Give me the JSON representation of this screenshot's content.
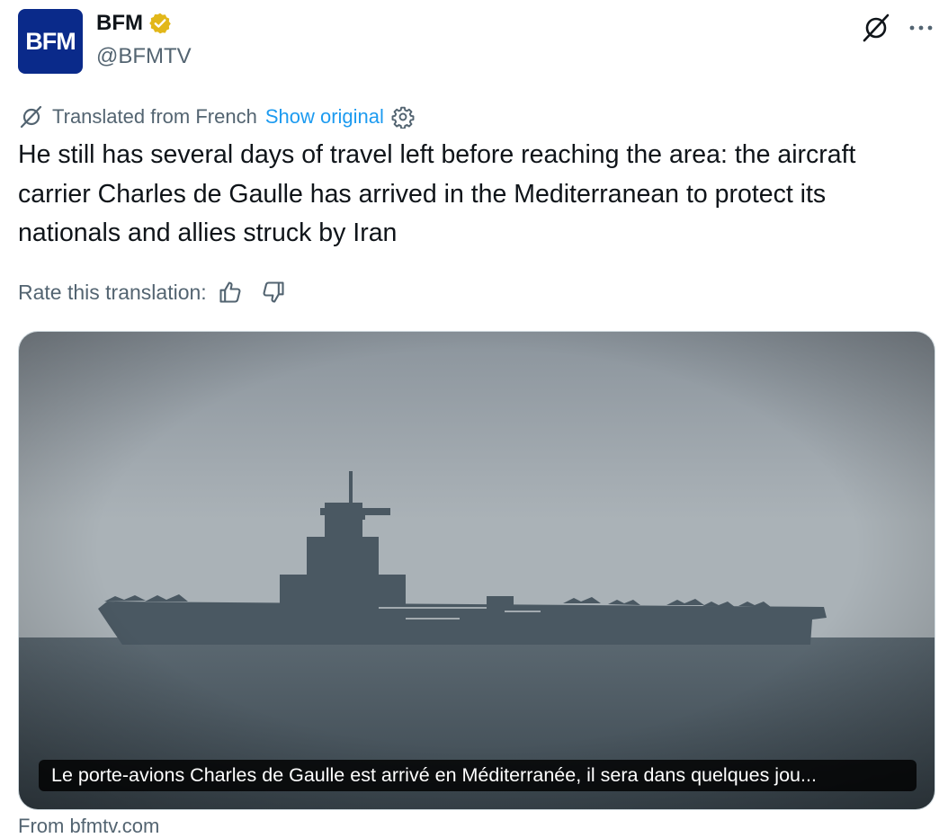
{
  "author": {
    "name": "BFM",
    "handle": "@BFMTV",
    "avatar_text": "BFM",
    "avatar_color": "#0a2a8a",
    "verified_color": "#e2b719"
  },
  "icons": {
    "grok": "grok-icon",
    "more": "more-icon",
    "translate": "translate-icon",
    "settings": "gear-icon",
    "thumb_up": "thumbs-up-icon",
    "thumb_down": "thumbs-down-icon"
  },
  "translation": {
    "label": "Translated from French",
    "show_original": "Show original",
    "link_color": "#1d9bf0"
  },
  "tweet": {
    "text": "He still has several days of travel left before reaching the area: the aircraft carrier Charles de Gaulle has arrived in the Mediterranean to protect its nationals and allies struck by Iran"
  },
  "rate": {
    "label": "Rate this translation:"
  },
  "media": {
    "caption": "Le porte-avions Charles de Gaulle est arrivé en Méditerranée, il sera dans quelques jou..."
  },
  "source": {
    "text": "From bfmtv.com"
  }
}
